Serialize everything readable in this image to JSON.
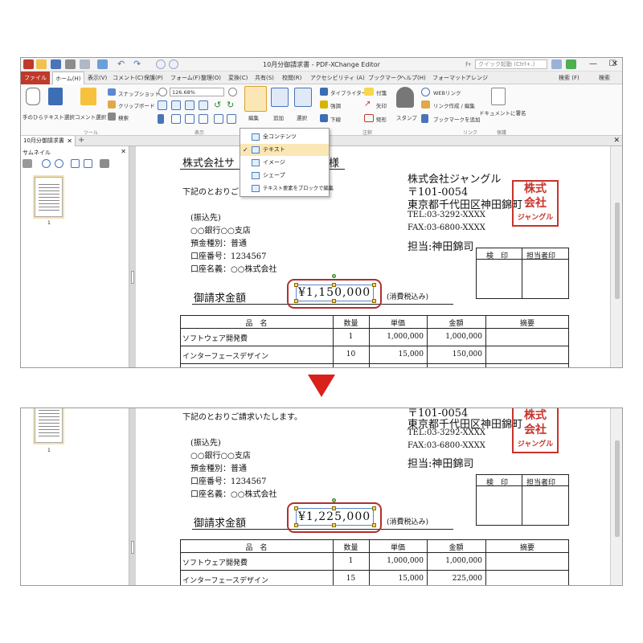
{
  "window": {
    "title": "10月分御請求書 - PDF-XChange Editor",
    "quick_label": "ﾁｬ",
    "quick_placeholder": "クイック起動 (Ctrl+.)",
    "minimize": "—",
    "maximize": "☐",
    "close": "✕"
  },
  "menu": {
    "file": "ファイル(F)",
    "items": [
      "ホーム(H)",
      "表示(V)",
      "コメント(C)",
      "保護(P)",
      "フォーム(F)",
      "整理(O)",
      "変換(C)",
      "共有(S)",
      "校閲(R)",
      "アクセシビリティ (A)",
      "ブックマーク",
      "ヘルプ(H)",
      "フォーマット",
      "アレンジ"
    ],
    "search1": "検索 (F)",
    "search2": "検索"
  },
  "ribbon": {
    "hand": "手のひら",
    "select_text": "テキスト選択",
    "select_comment": "コメント選択",
    "snapshot": "スナップショット",
    "clipboard": "クリップボード",
    "search": "検索",
    "zoom": "126.68%",
    "edit": "編集",
    "add": "追加",
    "select": "選択",
    "typewriter": "タイプライター",
    "sticky": "付箋",
    "highlight": "強調",
    "arrow": "矢印",
    "underline": "下線",
    "rect": "矩形",
    "stamp": "スタンプ",
    "weblink": "WEBリンク",
    "link_edit": "リンク作成 / 編集",
    "bookmark_add": "ブックマークを追加",
    "sign": "ドキュメントに署名",
    "groups": [
      "ツール",
      "表示",
      "注釈",
      "リンク",
      "保護"
    ]
  },
  "tabs": {
    "doc": "10月分御請求書",
    "close": "✕",
    "add": "+",
    "close_all": "✕"
  },
  "side": {
    "title": "サムネイル",
    "close": "✕",
    "page_num": "1"
  },
  "dropdown": {
    "items": [
      "全コンテンツ",
      "テキスト",
      "イメージ",
      "シェープ",
      "テキスト要素をブロックで編集"
    ],
    "check": "✓"
  },
  "doc": {
    "recipient": "株式会社サ",
    "recipient_suffix": "様",
    "intro_top": "下記のとおりご",
    "intro_full": "下記のとおりご請求いたします。",
    "company": "株式会社ジャングル",
    "postal": "〒101-0054",
    "address": "東京都千代田区神田錦町",
    "tel": "TEL:03-3292-XXXX",
    "fax": "FAX:03-6800-XXXX",
    "person": "担当:神田錦司",
    "bank_heading": "(振込先)",
    "bank": "○○銀行○○支店",
    "acct_type": "預金種別：普通",
    "acct_no": "口座番号：1234567",
    "acct_name": "口座名義：○○株式会社",
    "stamp_h1": "検　印",
    "stamp_h2": "担当者印",
    "amount_label": "御請求金額",
    "tax_note": "(消費税込み)",
    "seal_lines": [
      "株式",
      "会社",
      "ジャングル"
    ],
    "table_headers": [
      "品　名",
      "数量",
      "単価",
      "金額",
      "摘要"
    ]
  },
  "before": {
    "amount": "¥1,150,000",
    "rows": [
      {
        "name": "ソフトウェア開発費",
        "qty": "1",
        "price": "1,000,000",
        "total": "1,000,000"
      },
      {
        "name": "インターフェースデザイン",
        "qty": "10",
        "price": "15,000",
        "total": "150,000"
      }
    ]
  },
  "after": {
    "amount": "¥1,225,000",
    "rows": [
      {
        "name": "ソフトウェア開発費",
        "qty": "1",
        "price": "1,000,000",
        "total": "1,000,000"
      },
      {
        "name": "インターフェースデザイン",
        "qty": "15",
        "price": "15,000",
        "total": "225,000"
      }
    ]
  },
  "colors": {
    "accent_red": "#d9201a",
    "seal_red": "#c8332b",
    "file_menu": "#c0392b",
    "selection": "#fbe7b5"
  }
}
